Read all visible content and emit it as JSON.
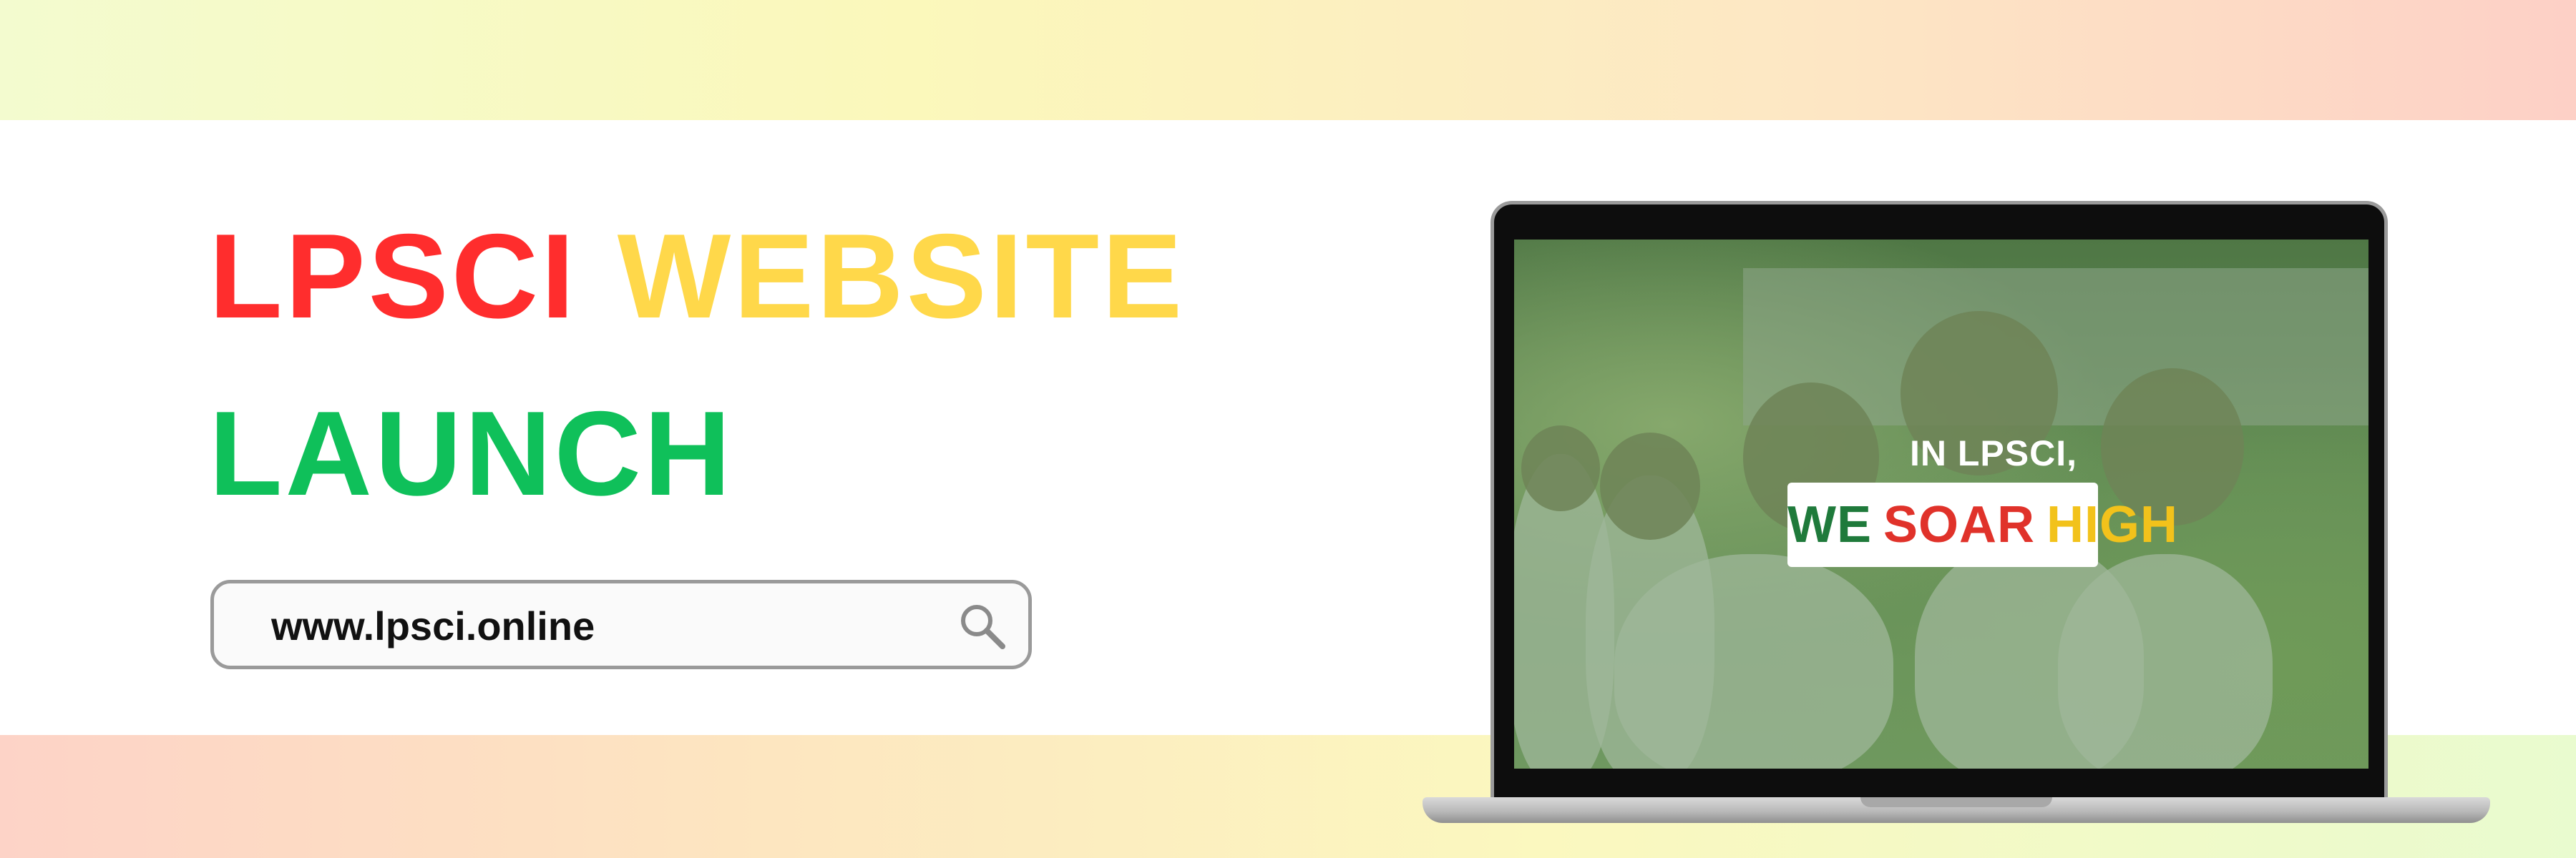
{
  "headline": {
    "word1": "LPSCI",
    "word2": "WEBSITE",
    "word3": "LAUNCH"
  },
  "search": {
    "value": "www.lpsci.online",
    "icon": "search-icon"
  },
  "laptop": {
    "overlay_line1": "IN LPSCI,",
    "overlay_we": "WE",
    "overlay_soar": "SOAR",
    "overlay_high": "HIGH"
  },
  "colors": {
    "red": "#ff2d2d",
    "yellow": "#ffd84a",
    "green": "#0fc05a"
  }
}
